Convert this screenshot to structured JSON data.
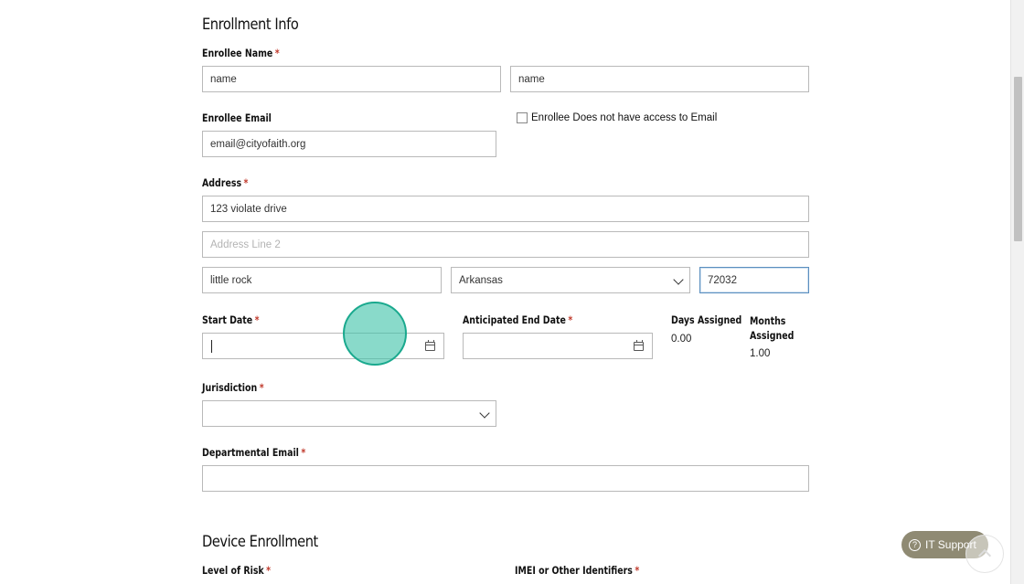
{
  "enrollment": {
    "title": "Enrollment Info",
    "name_label": "Enrollee Name",
    "first_name": "name",
    "last_name": "name",
    "email_label": "Enrollee Email",
    "email_value": "email@cityofaith.org",
    "no_email_label": "Enrollee Does not have access to Email",
    "no_email_checked": false,
    "address_label": "Address",
    "address_line1": "123 violate drive",
    "address_line2_placeholder": "Address Line 2",
    "city": "little rock",
    "state": "Arkansas",
    "zip": "72032",
    "start_date_label": "Start Date",
    "start_date_value": "",
    "end_date_label": "Anticipated End Date",
    "end_date_value": "",
    "days_assigned_label": "Days Assigned",
    "days_assigned_value": "0.00",
    "months_assigned_label": "Months Assigned",
    "months_assigned_value": "1.00",
    "jurisdiction_label": "Jurisdiction",
    "jurisdiction_value": "",
    "dept_email_label": "Departmental Email",
    "dept_email_value": "",
    "required_mark": "*"
  },
  "device": {
    "title": "Device Enrollment",
    "risk_label": "Level of Risk",
    "imei_label": "IMEI or Other Identifiers"
  },
  "support": {
    "label": "IT Support",
    "icon": "question-circle-icon"
  },
  "colors": {
    "required": "#c0392b",
    "support_button": "#8f8a73",
    "touch_indicator": "#40c4aa",
    "focus_border": "#5b8fbf"
  }
}
